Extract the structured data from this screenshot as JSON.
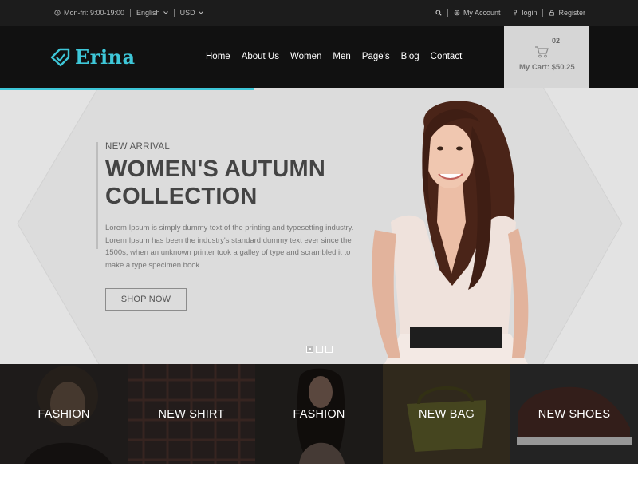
{
  "topbar": {
    "hours": "Mon-fri: 9:00-19:00",
    "language": "English",
    "currency": "USD",
    "account": "My Account",
    "login": "login",
    "register": "Register"
  },
  "header": {
    "logo": "Erina",
    "nav": [
      "Home",
      "About Us",
      "Women",
      "Men",
      "Page's",
      "Blog",
      "Contact"
    ],
    "cart_count": "02",
    "cart_label": "My Cart: $50.25"
  },
  "hero": {
    "kicker": "NEW ARRIVAL",
    "headline_line1": "WOMEN'S AUTUMN",
    "headline_line2": "COLLECTION",
    "description": "Lorem Ipsum is simply dummy text of the printing and typesetting industry. Lorem Ipsum has been the industry's standard dummy text ever since the 1500s, when an unknown printer took a galley of type and scrambled it to make a type specimen book.",
    "button": "SHOP NOW",
    "slides": 3,
    "active_slide": 1
  },
  "categories": [
    {
      "label": "FASHION"
    },
    {
      "label": "NEW SHIRT"
    },
    {
      "label": "FASHION"
    },
    {
      "label": "NEW BAG"
    },
    {
      "label": "NEW SHOES"
    }
  ],
  "colors": {
    "accent": "#3ec7d8",
    "topbar_bg": "#1c1c1c",
    "header_bg": "#111111",
    "hero_bg": "#e3e3e3",
    "cart_bg": "#d6d6d6"
  }
}
